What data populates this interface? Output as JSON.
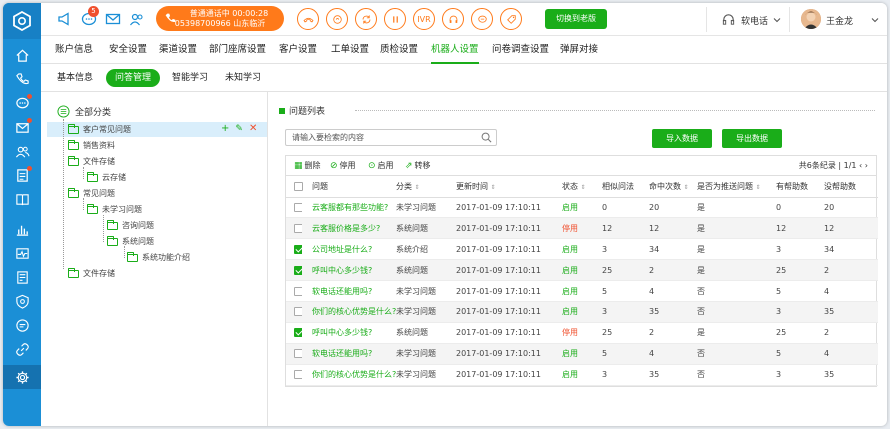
{
  "sidebar": {
    "icons": [
      "logo-icon",
      "home-icon",
      "phone-icon",
      "chat-icon",
      "mail-icon",
      "users-icon",
      "task-icon",
      "book-icon",
      "bar-chart-icon",
      "monitor-icon",
      "report-icon",
      "shield-icon",
      "message-icon",
      "link-icon",
      "gear-icon"
    ]
  },
  "topbar": {
    "badge": "5",
    "call_status_line1": "普通通话中 00:00:28",
    "call_status_line2": "05398700966 山东临沂",
    "ivr": "IVR",
    "switch_label": "切换到老版",
    "phone_label": "软电话",
    "user_name": "王金龙"
  },
  "nav": {
    "items": [
      "账户信息",
      "安全设置",
      "渠道设置",
      "部门座席设置",
      "客户设置",
      "工单设置",
      "质检设置",
      "机器人设置",
      "问卷调查设置",
      "弹屏对接"
    ],
    "active": "机器人设置"
  },
  "subnav": {
    "items": [
      "基本信息",
      "问答管理",
      "智能学习",
      "未知学习"
    ],
    "active": "问答管理"
  },
  "tree": {
    "root": "全部分类",
    "nodes": [
      "客户常见问题",
      "销售资料",
      "文件存储",
      "云存储",
      "常见问题",
      "未学习问题",
      "咨询问题",
      "系统问题",
      "系统功能介绍",
      "文件存储"
    ],
    "actions": [
      "+",
      "✎",
      "✕"
    ]
  },
  "main": {
    "title": "问题列表",
    "search_placeholder": "请输入要检索的内容",
    "import_label": "导入数据",
    "export_label": "导出数据",
    "tools": [
      "删除",
      "停用",
      "启用",
      "转移"
    ],
    "pager": "共6条纪录 | 1/1",
    "columns": [
      "问题",
      "分类",
      "更新时间",
      "状态",
      "相似问法",
      "命中次数",
      "是否为推送问题",
      "有帮助数",
      "没帮助数"
    ],
    "rows": [
      {
        "checked": false,
        "q": "云客服都有那些功能?",
        "cat": "未学习问题",
        "time": "2017-01-09  17:10:11",
        "status": "启用",
        "status_on": true,
        "sim": "0",
        "hits": "20",
        "push": "是",
        "help": "0",
        "nohelp": "20"
      },
      {
        "checked": false,
        "q": "云客服价格是多少?",
        "cat": "系统问题",
        "time": "2017-01-09  17:10:11",
        "status": "停用",
        "status_on": false,
        "sim": "12",
        "hits": "12",
        "push": "是",
        "help": "12",
        "nohelp": "12"
      },
      {
        "checked": true,
        "q": "公司地址是什么?",
        "cat": "系统介绍",
        "time": "2017-01-09  17:10:11",
        "status": "启用",
        "status_on": true,
        "sim": "3",
        "hits": "34",
        "push": "是",
        "help": "3",
        "nohelp": "34"
      },
      {
        "checked": true,
        "q": "呼叫中心多少钱?",
        "cat": "系统问题",
        "time": "2017-01-09  17:10:11",
        "status": "启用",
        "status_on": true,
        "sim": "25",
        "hits": "2",
        "push": "是",
        "help": "25",
        "nohelp": "2"
      },
      {
        "checked": false,
        "q": "软电话还能用吗?",
        "cat": "未学习问题",
        "time": "2017-01-09  17:10:11",
        "status": "启用",
        "status_on": true,
        "sim": "5",
        "hits": "4",
        "push": "否",
        "help": "5",
        "nohelp": "4"
      },
      {
        "checked": false,
        "q": "你们的核心优势是什么?",
        "cat": "未学习问题",
        "time": "2017-01-09  17:10:11",
        "status": "启用",
        "status_on": true,
        "sim": "3",
        "hits": "35",
        "push": "否",
        "help": "3",
        "nohelp": "35"
      },
      {
        "checked": true,
        "q": "呼叫中心多少钱?",
        "cat": "系统问题",
        "time": "2017-01-09  17:10:11",
        "status": "停用",
        "status_on": false,
        "sim": "25",
        "hits": "2",
        "push": "是",
        "help": "25",
        "nohelp": "2"
      },
      {
        "checked": false,
        "q": "软电话还能用吗?",
        "cat": "未学习问题",
        "time": "2017-01-09  17:10:11",
        "status": "启用",
        "status_on": true,
        "sim": "5",
        "hits": "4",
        "push": "否",
        "help": "5",
        "nohelp": "4"
      },
      {
        "checked": false,
        "q": "你们的核心优势是什么?",
        "cat": "未学习问题",
        "time": "2017-01-09  17:10:11",
        "status": "启用",
        "status_on": true,
        "sim": "3",
        "hits": "35",
        "push": "否",
        "help": "3",
        "nohelp": "35"
      }
    ]
  }
}
